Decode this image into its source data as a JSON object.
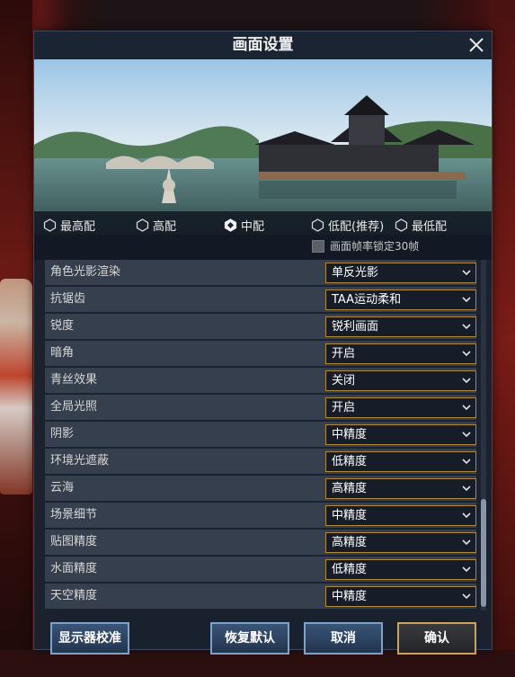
{
  "dialog": {
    "title": "画面设置"
  },
  "presets": [
    {
      "label": "最高配",
      "selected": false
    },
    {
      "label": "高配",
      "selected": false
    },
    {
      "label": "中配",
      "selected": true
    },
    {
      "label": "低配(推荐)",
      "selected": false
    },
    {
      "label": "最低配",
      "selected": false
    }
  ],
  "lock_fps": {
    "label": "画面帧率锁定30帧",
    "checked": false
  },
  "settings": [
    {
      "label": "角色光影渲染",
      "value": "单反光影"
    },
    {
      "label": "抗锯齿",
      "value": "TAA运动柔和"
    },
    {
      "label": "锐度",
      "value": "锐利画面"
    },
    {
      "label": "暗角",
      "value": "开启"
    },
    {
      "label": "青丝效果",
      "value": "关闭"
    },
    {
      "label": "全局光照",
      "value": "开启"
    },
    {
      "label": "阴影",
      "value": "中精度"
    },
    {
      "label": "环境光遮蔽",
      "value": "低精度"
    },
    {
      "label": "云海",
      "value": "高精度"
    },
    {
      "label": "场景细节",
      "value": "中精度"
    },
    {
      "label": "贴图精度",
      "value": "高精度"
    },
    {
      "label": "水面精度",
      "value": "低精度"
    },
    {
      "label": "天空精度",
      "value": "中精度"
    }
  ],
  "buttons": {
    "calibrate": "显示器校准",
    "restore": "恢复默认",
    "cancel": "取消",
    "confirm": "确认"
  },
  "colors": {
    "accent_gold": "#b08a3a",
    "button_blue": "#7fa2c8"
  }
}
